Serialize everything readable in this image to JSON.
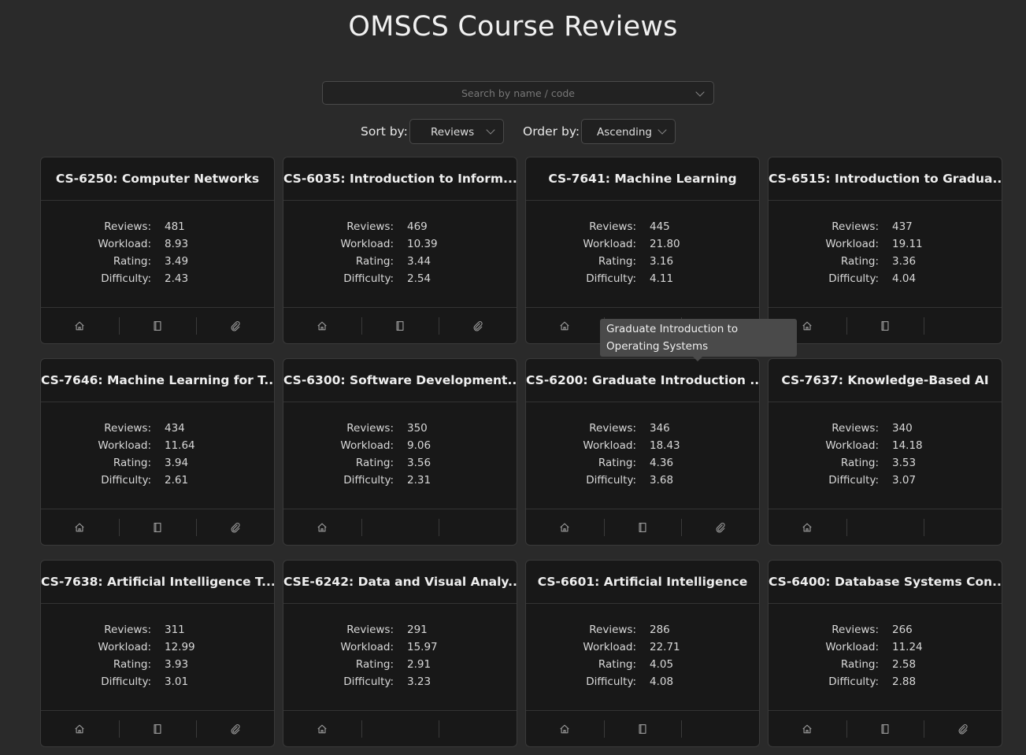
{
  "title": "OMSCS Course Reviews",
  "search": {
    "placeholder": "Search by name / code",
    "value": ""
  },
  "sort": {
    "label": "Sort by:",
    "value": "Reviews"
  },
  "order": {
    "label": "Order by:",
    "value": "Ascending"
  },
  "stat_labels": {
    "reviews": "Reviews:",
    "workload": "Workload:",
    "rating": "Rating:",
    "difficulty": "Difficulty:"
  },
  "tooltip": {
    "text": "Graduate Introduction to Operating Systems"
  },
  "icons": {
    "home": "home-icon",
    "book": "book-icon",
    "link": "paperclip-icon"
  },
  "courses": [
    {
      "title": "CS-6250: Computer Networks",
      "reviews": "481",
      "workload": "8.93",
      "rating": "3.49",
      "difficulty": "2.43",
      "home": true,
      "book": true,
      "link": true
    },
    {
      "title": "CS-6035: Introduction to Inform...",
      "reviews": "469",
      "workload": "10.39",
      "rating": "3.44",
      "difficulty": "2.54",
      "home": true,
      "book": true,
      "link": true
    },
    {
      "title": "CS-7641: Machine Learning",
      "reviews": "445",
      "workload": "21.80",
      "rating": "3.16",
      "difficulty": "4.11",
      "home": true,
      "book": false,
      "link": false
    },
    {
      "title": "CS-6515: Introduction to Gradua...",
      "reviews": "437",
      "workload": "19.11",
      "rating": "3.36",
      "difficulty": "4.04",
      "home": true,
      "book": true,
      "link": false
    },
    {
      "title": "CS-7646: Machine Learning for T...",
      "reviews": "434",
      "workload": "11.64",
      "rating": "3.94",
      "difficulty": "2.61",
      "home": true,
      "book": true,
      "link": true
    },
    {
      "title": "CS-6300: Software Development...",
      "reviews": "350",
      "workload": "9.06",
      "rating": "3.56",
      "difficulty": "2.31",
      "home": true,
      "book": false,
      "link": false
    },
    {
      "title": "CS-6200: Graduate Introduction ...",
      "reviews": "346",
      "workload": "18.43",
      "rating": "4.36",
      "difficulty": "3.68",
      "home": true,
      "book": true,
      "link": true
    },
    {
      "title": "CS-7637: Knowledge-Based AI",
      "reviews": "340",
      "workload": "14.18",
      "rating": "3.53",
      "difficulty": "3.07",
      "home": true,
      "book": false,
      "link": false
    },
    {
      "title": "CS-7638: Artificial Intelligence T...",
      "reviews": "311",
      "workload": "12.99",
      "rating": "3.93",
      "difficulty": "3.01",
      "home": true,
      "book": true,
      "link": true
    },
    {
      "title": "CSE-6242: Data and Visual Analy...",
      "reviews": "291",
      "workload": "15.97",
      "rating": "2.91",
      "difficulty": "3.23",
      "home": true,
      "book": false,
      "link": false
    },
    {
      "title": "CS-6601: Artificial Intelligence",
      "reviews": "286",
      "workload": "22.71",
      "rating": "4.05",
      "difficulty": "4.08",
      "home": true,
      "book": true,
      "link": false
    },
    {
      "title": "CS-6400: Database Systems Con...",
      "reviews": "266",
      "workload": "11.24",
      "rating": "2.58",
      "difficulty": "2.88",
      "home": true,
      "book": true,
      "link": true
    }
  ]
}
